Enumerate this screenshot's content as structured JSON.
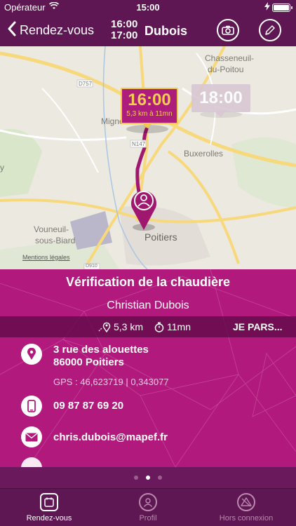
{
  "status_bar": {
    "carrier": "Opérateur",
    "time": "15:00"
  },
  "header": {
    "back_label": "Rendez-vous",
    "time_start": "16:00",
    "time_end": "17:00",
    "client_name": "Dubois"
  },
  "map": {
    "places": [
      "Chasseneuil-",
      "du-Poitou",
      "Migné",
      "Buxerolles",
      "Vouneuil-",
      "sous-Biard",
      "Poitiers",
      "y"
    ],
    "roads": [
      "D757",
      "N147",
      "D910"
    ],
    "mentions_label": "Mentions légales",
    "bubble_current": {
      "time": "16:00",
      "subtitle": "5,3 km à 11mn"
    },
    "bubble_next": {
      "time": "18:00"
    },
    "route_color": "#a0176f"
  },
  "appointment": {
    "title": "Vérification de la chaudière",
    "client": "Christian Dubois",
    "distance": "5,3 km",
    "duration": "11mn",
    "go_label": "JE PARS...",
    "address_line1": "3 rue des alouettes",
    "address_line2": "86000 Poitiers",
    "gps": "GPS : 46,623719 | 0,343077",
    "phone": "09 87 87 69 20",
    "email": "chris.dubois@mapef.fr"
  },
  "pager": {
    "count": 3,
    "active_index": 1
  },
  "tabs": [
    {
      "label": "Rendez-vous",
      "icon": "calendar-icon",
      "active": true
    },
    {
      "label": "Profil",
      "icon": "user-icon",
      "active": false
    },
    {
      "label": "Hors connexion",
      "icon": "offline-icon",
      "active": false
    }
  ],
  "colors": {
    "brand_purple": "#5e1752",
    "panel_magenta": "#b2197d",
    "accent_gold": "#f4c94a"
  }
}
